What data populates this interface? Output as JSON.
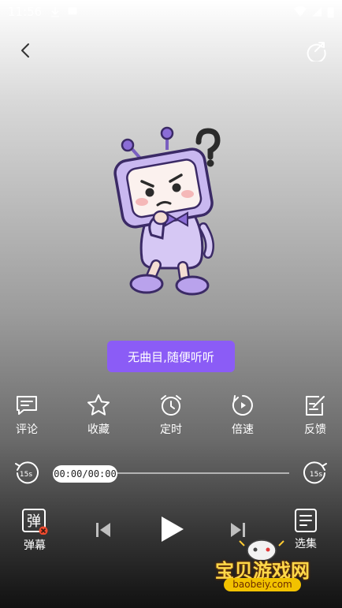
{
  "status_bar": {
    "time": "11:56"
  },
  "empty_tip": "无曲目,随便听听",
  "actions": [
    {
      "key": "comment",
      "label": "评论",
      "icon": "comment-icon"
    },
    {
      "key": "favorite",
      "label": "收藏",
      "icon": "star-icon"
    },
    {
      "key": "timer",
      "label": "定时",
      "icon": "alarm-clock-icon"
    },
    {
      "key": "speed",
      "label": "倍速",
      "icon": "speed-icon"
    },
    {
      "key": "feedback",
      "label": "反馈",
      "icon": "edit-note-icon"
    }
  ],
  "player": {
    "time_display": "00:00/00:00",
    "skip_back_label": "15s",
    "skip_forward_label": "15s",
    "progress": 0
  },
  "controls": {
    "danmaku_label": "弹幕",
    "danmaku_glyph": "弹",
    "episodes_label": "选集"
  },
  "watermark": {
    "text": "宝贝游戏网",
    "url": "baobeiy.com"
  },
  "colors": {
    "accent": "#8b5cf6",
    "mascot_purple": "#c9b8f0"
  }
}
